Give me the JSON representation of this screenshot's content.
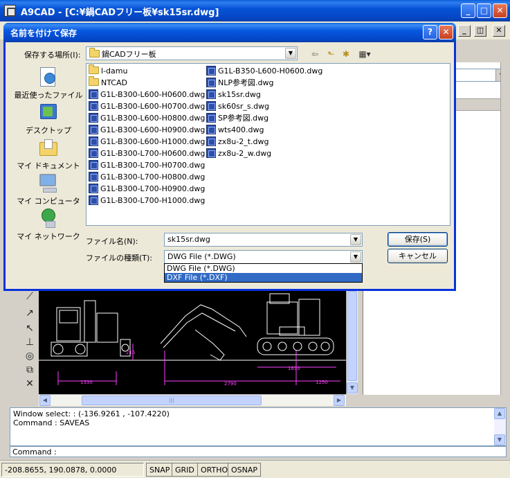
{
  "app": {
    "title": "A9CAD - [C:¥鍋CADフリー板¥sk15sr.dwg]",
    "caption_buttons": {
      "minimize": "_",
      "maximize": "□",
      "close": "✕"
    },
    "mdi_buttons": {
      "minimize": "_",
      "restore": "◫",
      "close": "✕"
    }
  },
  "command_window": {
    "history": [
      "Window select: : (-136.9261 , -107.4220)",
      "Command : SAVEAS"
    ],
    "prompt_label": "Command :"
  },
  "statusbar": {
    "coords": "-208.8655, 190.0878, 0.0000",
    "toggles": [
      "SNAP",
      "GRID",
      "ORTHO",
      "OSNAP"
    ]
  },
  "canvas": {
    "dimensions": [
      "1330",
      "2790",
      "1830",
      "1250",
      "215"
    ]
  },
  "dialog": {
    "title": "名前を付けて保存",
    "caption_buttons": {
      "help": "?",
      "close": "✕"
    },
    "save_in_label": "保存する場所(I):",
    "save_in_value": "鍋CADフリー板",
    "places": [
      {
        "label": "最近使ったファイル",
        "icon": "recent-documents-icon"
      },
      {
        "label": "デスクトップ",
        "icon": "desktop-icon"
      },
      {
        "label": "マイ ドキュメント",
        "icon": "my-documents-icon"
      },
      {
        "label": "マイ コンピュータ",
        "icon": "my-computer-icon"
      },
      {
        "label": "マイ ネットワーク",
        "icon": "my-network-icon"
      }
    ],
    "files_col1": [
      {
        "name": "l-damu",
        "type": "folder"
      },
      {
        "name": "NTCAD",
        "type": "folder"
      },
      {
        "name": "G1L-B300-L600-H0600.dwg",
        "type": "dwg"
      },
      {
        "name": "G1L-B300-L600-H0700.dwg",
        "type": "dwg"
      },
      {
        "name": "G1L-B300-L600-H0800.dwg",
        "type": "dwg"
      },
      {
        "name": "G1L-B300-L600-H0900.dwg",
        "type": "dwg"
      },
      {
        "name": "G1L-B300-L600-H1000.dwg",
        "type": "dwg"
      },
      {
        "name": "G1L-B300-L700-H0600.dwg",
        "type": "dwg"
      },
      {
        "name": "G1L-B300-L700-H0700.dwg",
        "type": "dwg"
      },
      {
        "name": "G1L-B300-L700-H0800.dwg",
        "type": "dwg"
      },
      {
        "name": "G1L-B300-L700-H0900.dwg",
        "type": "dwg"
      },
      {
        "name": "G1L-B300-L700-H1000.dwg",
        "type": "dwg"
      }
    ],
    "files_col2": [
      {
        "name": "G1L-B350-L600-H0600.dwg",
        "type": "dwg"
      },
      {
        "name": "NLP参考図.dwg",
        "type": "dwg"
      },
      {
        "name": "sk15sr.dwg",
        "type": "dwg"
      },
      {
        "name": "sk60sr_s.dwg",
        "type": "dwg"
      },
      {
        "name": "SP参考図.dwg",
        "type": "dwg"
      },
      {
        "name": "wts400.dwg",
        "type": "dwg"
      },
      {
        "name": "zx8u-2_t.dwg",
        "type": "dwg"
      },
      {
        "name": "zx8u-2_w.dwg",
        "type": "dwg"
      }
    ],
    "filename_label": "ファイル名(N):",
    "filename_value": "sk15sr.dwg",
    "filetype_label": "ファイルの種類(T):",
    "filetype_value": "DWG File (*.DWG)",
    "filetype_options": [
      "DWG File (*.DWG)",
      "DXF File (*.DXF)"
    ],
    "filetype_selected_index": 1,
    "save_button": "保存(S)",
    "cancel_button": "キャンセル"
  }
}
